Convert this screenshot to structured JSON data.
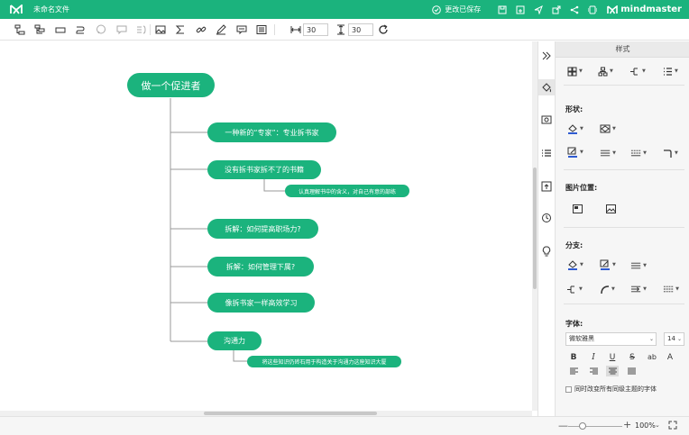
{
  "titlebar": {
    "doc_title": "未命名文件",
    "save_status": "更改已保存",
    "brand": "mindmaster",
    "bg_color": "#1bb37d"
  },
  "toolbar": {
    "width_value": "30",
    "height_value": "30"
  },
  "mindmap": {
    "root": "做一个促进者",
    "topics": [
      {
        "label": "一种新的“专家”：专业拆书家"
      },
      {
        "label": "没有拆书家拆不了的书籍",
        "sub": "认真理解书中的含义，对自己有意的部练"
      },
      {
        "label": "拆解：如何提高职场力?"
      },
      {
        "label": "拆解：如何管理下属?"
      },
      {
        "label": "像拆书家一样高效学习"
      },
      {
        "label": "沟通力",
        "sub": "将这些知识仍砖石用于构造关于沟通力这座知识大厦"
      }
    ],
    "node_color": "#1bb37d",
    "line_color": "#9a9a9a"
  },
  "panel": {
    "header": "样式",
    "shape_title": "形状:",
    "image_pos_title": "图片位置:",
    "branch_title": "分支:",
    "font_title": "字体:",
    "font_family": "微软雅黑",
    "font_size": "14",
    "bold": "B",
    "italic": "I",
    "underline": "U",
    "strike": "S",
    "case": "ab",
    "caps": "A",
    "checkbox_label": "同时改变所有同级主题的字体"
  },
  "statusbar": {
    "zoom_minus": "—",
    "zoom_plus": "+",
    "zoom_level": "100%",
    "zoom_caret": "⌄"
  }
}
